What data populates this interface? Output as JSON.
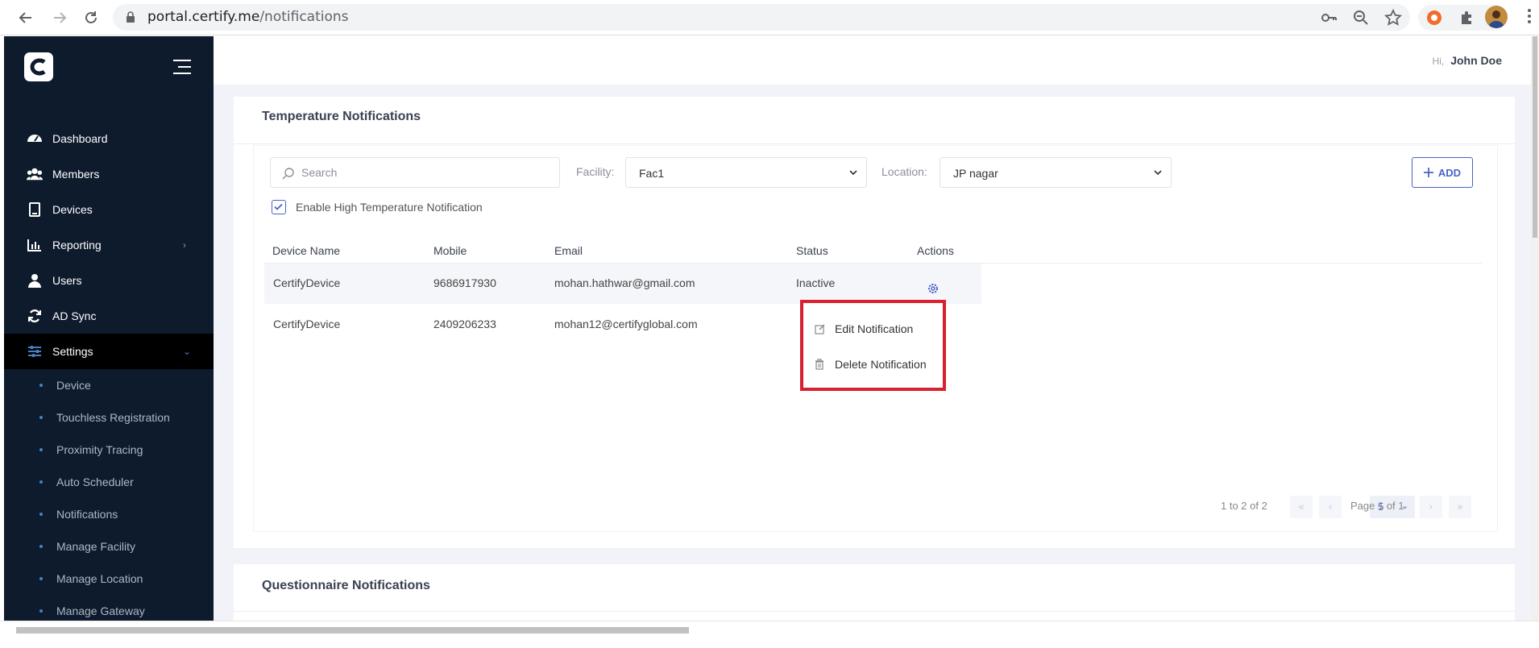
{
  "browser": {
    "url_host": "portal.certify.me",
    "url_path": "/notifications"
  },
  "sidebar": {
    "items": [
      {
        "label": "Dashboard",
        "icon": "dashboard-icon"
      },
      {
        "label": "Members",
        "icon": "members-icon"
      },
      {
        "label": "Devices",
        "icon": "tablet-icon"
      },
      {
        "label": "Reporting",
        "icon": "chart-icon"
      },
      {
        "label": "Users",
        "icon": "user-icon"
      },
      {
        "label": "AD Sync",
        "icon": "sync-icon"
      },
      {
        "label": "Settings",
        "icon": "sliders-icon"
      }
    ],
    "settings_sub": [
      "Device",
      "Touchless Registration",
      "Proximity Tracing",
      "Auto Scheduler",
      "Notifications",
      "Manage Facility",
      "Manage Location",
      "Manage Gateway"
    ]
  },
  "header": {
    "greeting": "Hi,",
    "user_name": "John Doe"
  },
  "temperature": {
    "title": "Temperature Notifications",
    "search_placeholder": "Search",
    "facility_label": "Facility:",
    "facility_value": "Fac1",
    "location_label": "Location:",
    "location_value": "JP nagar",
    "add_label": "ADD",
    "checkbox_label": "Enable High Temperature Notification",
    "columns": [
      "Device Name",
      "Mobile",
      "Email",
      "Status",
      "Actions"
    ],
    "rows": [
      {
        "device": "CertifyDevice",
        "mobile": "9686917930",
        "email": "mohan.hathwar@gmail.com",
        "status": "Inactive"
      },
      {
        "device": "CertifyDevice",
        "mobile": "2409206233",
        "email": "mohan12@certifyglobal.com",
        "status": ""
      }
    ],
    "menu": {
      "edit": "Edit Notification",
      "delete": "Delete Notification"
    },
    "pager": {
      "page_size": "5",
      "range": "1 to 2 of 2",
      "page": "Page 1 of 1"
    }
  },
  "questionnaire": {
    "title": "Questionnaire Notifications"
  }
}
